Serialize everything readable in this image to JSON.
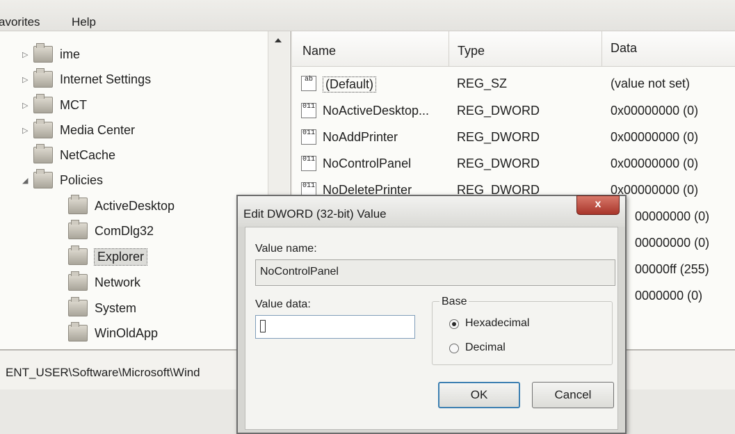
{
  "menubar": {
    "favorites": "avorites",
    "help": "Help"
  },
  "tree": {
    "items": [
      {
        "label": "ime",
        "expander": "▷"
      },
      {
        "label": "Internet Settings",
        "expander": "▷"
      },
      {
        "label": "MCT",
        "expander": "▷"
      },
      {
        "label": "Media Center",
        "expander": "▷"
      },
      {
        "label": "NetCache",
        "expander": ""
      },
      {
        "label": "Policies",
        "expander": "◢"
      },
      {
        "label": "ActiveDesktop"
      },
      {
        "label": "ComDlg32"
      },
      {
        "label": "Explorer"
      },
      {
        "label": "Network"
      },
      {
        "label": "System"
      },
      {
        "label": "WinOldApp"
      }
    ]
  },
  "list": {
    "columns": {
      "name": "Name",
      "type": "Type",
      "data": "Data"
    },
    "rows": [
      {
        "icon": "ab",
        "name": "(Default)",
        "type": "REG_SZ",
        "data": "(value not set)"
      },
      {
        "icon": "011",
        "name": "NoActiveDesktop...",
        "type": "REG_DWORD",
        "data": "0x00000000 (0)"
      },
      {
        "icon": "011",
        "name": "NoAddPrinter",
        "type": "REG_DWORD",
        "data": "0x00000000 (0)"
      },
      {
        "icon": "011",
        "name": "NoControlPanel",
        "type": "REG_DWORD",
        "data": "0x00000000 (0)"
      },
      {
        "icon": "011",
        "name": "NoDeletePrinter",
        "type": "REG_DWORD",
        "data": "0x00000000 (0)"
      },
      {
        "data": "00000000 (0)"
      },
      {
        "data": "00000000 (0)"
      },
      {
        "data": "00000ff (255)"
      },
      {
        "data": "0000000 (0)"
      }
    ]
  },
  "statusbar": {
    "path": "ENT_USER\\Software\\Microsoft\\Wind"
  },
  "dialog": {
    "title": "Edit DWORD (32-bit) Value",
    "close_label": "x",
    "value_name_label": "Value name:",
    "value_name": "NoControlPanel",
    "value_data_label": "Value data:",
    "value_data": "",
    "base_label": "Base",
    "hex_label": "Hexadecimal",
    "dec_label": "Decimal",
    "selected_base": "Hexadecimal",
    "ok_label": "OK",
    "cancel_label": "Cancel"
  }
}
